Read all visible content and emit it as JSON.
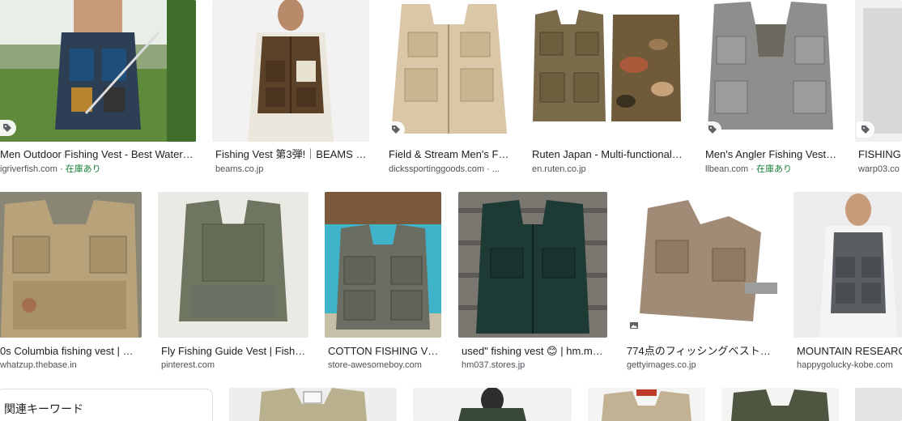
{
  "row1": [
    {
      "title": "Men Outdoor Fishing Vest - Best Water Ja...",
      "source": "igriverfish.com",
      "stock": "在庫あり",
      "badge": "tag-icon"
    },
    {
      "title": "Fishing Vest 第3弾!｜BEAMS PL...",
      "source": "beams.co.jp",
      "stock": "",
      "badge": ""
    },
    {
      "title": "Field & Stream Men's Fly ...",
      "source": "dickssportinggoods.com · ...",
      "stock": "",
      "badge": "tag-icon"
    },
    {
      "title": "Ruten Japan - Multi-functional v...",
      "source": "en.ruten.co.jp",
      "stock": "",
      "badge": ""
    },
    {
      "title": "Men's Angler Fishing Vest | ...",
      "source": "llbean.com",
      "stock": "在庫あり",
      "badge": "tag-icon"
    },
    {
      "title": "FISHING V",
      "source": "warp03.co",
      "stock": "",
      "badge": "tag-icon"
    }
  ],
  "row2": [
    {
      "title": "0s Columbia fishing vest | W...",
      "source": "whatzup.thebase.in",
      "stock": "",
      "badge": ""
    },
    {
      "title": "Fly Fishing Guide Vest | Fishin...",
      "source": "pinterest.com",
      "stock": "",
      "badge": ""
    },
    {
      "title": "COTTON FISHING VES...",
      "source": "store-awesomeboy.com",
      "stock": "",
      "badge": ""
    },
    {
      "title": "used\" fishing vest 😊 | hm.moi...",
      "source": "hm037.stores.jp",
      "stock": "",
      "badge": ""
    },
    {
      "title": "774点のフィッシングベストの...",
      "source": "gettyimages.co.jp",
      "stock": "",
      "badge": "image-icon"
    },
    {
      "title": "MOUNTAIN RESEARCH/",
      "source": "happygolucky-kobe.com",
      "stock": "",
      "badge": ""
    }
  ],
  "related": {
    "title": "関連キーワード"
  },
  "separator": " · "
}
